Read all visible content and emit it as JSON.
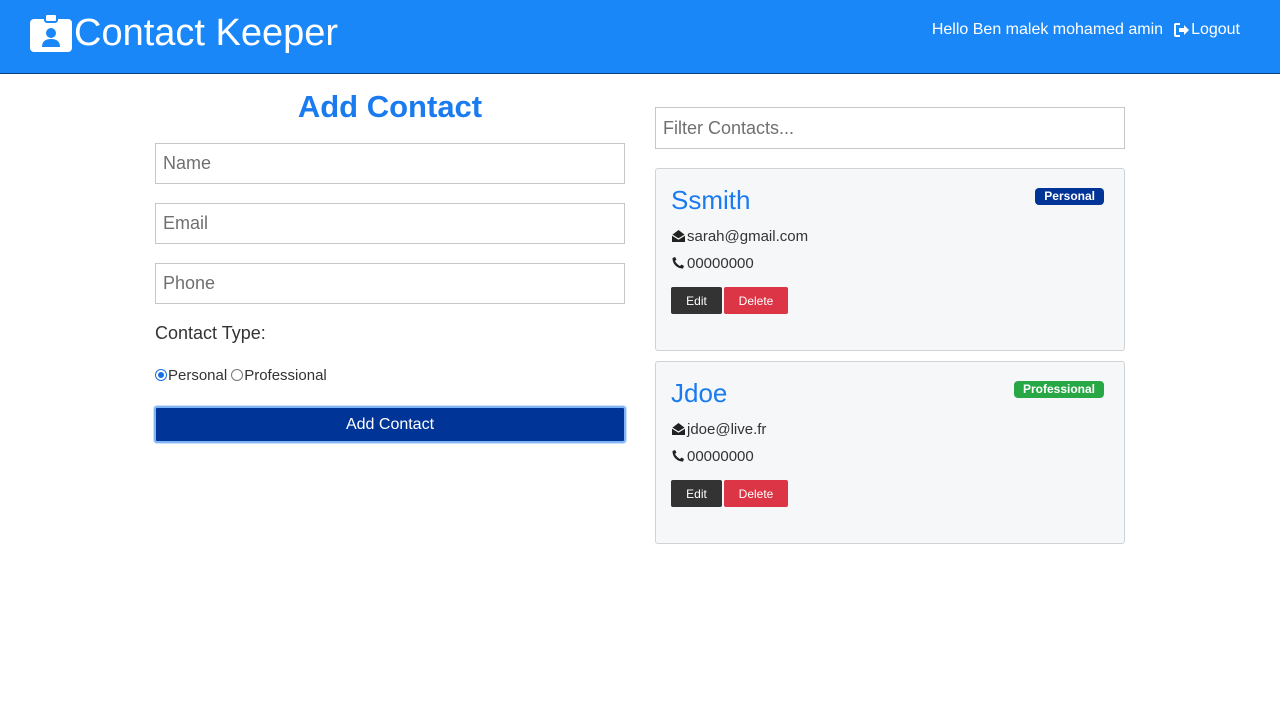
{
  "navbar": {
    "title": "Contact Keeper",
    "greeting": "Hello Ben malek mohamed amin",
    "logout_label": "Logout",
    "background": "#1a87f9"
  },
  "form": {
    "title": "Add Contact",
    "name_placeholder": "Name",
    "email_placeholder": "Email",
    "phone_placeholder": "Phone",
    "type_label": "Contact Type:",
    "type_options": [
      "Personal",
      "Professional"
    ],
    "selected_type": "Personal",
    "submit_label": "Add Contact"
  },
  "filter": {
    "placeholder": "Filter Contacts..."
  },
  "contacts": [
    {
      "name": "Ssmith",
      "type": "Personal",
      "email": "sarah@gmail.com",
      "phone": "00000000",
      "edit_label": "Edit",
      "delete_label": "Delete"
    },
    {
      "name": "Jdoe",
      "type": "Professional",
      "email": "jdoe@live.fr",
      "phone": "00000000",
      "edit_label": "Edit",
      "delete_label": "Delete"
    }
  ],
  "icons": {
    "brand": "id-badge-icon",
    "logout": "sign-out-icon",
    "email": "envelope-open-icon",
    "phone": "phone-icon"
  },
  "colors": {
    "accent": "#1a7bf0",
    "personal_badge": "#003497",
    "professional_badge": "#28a745",
    "delete": "#dc3545",
    "edit": "#333333"
  }
}
